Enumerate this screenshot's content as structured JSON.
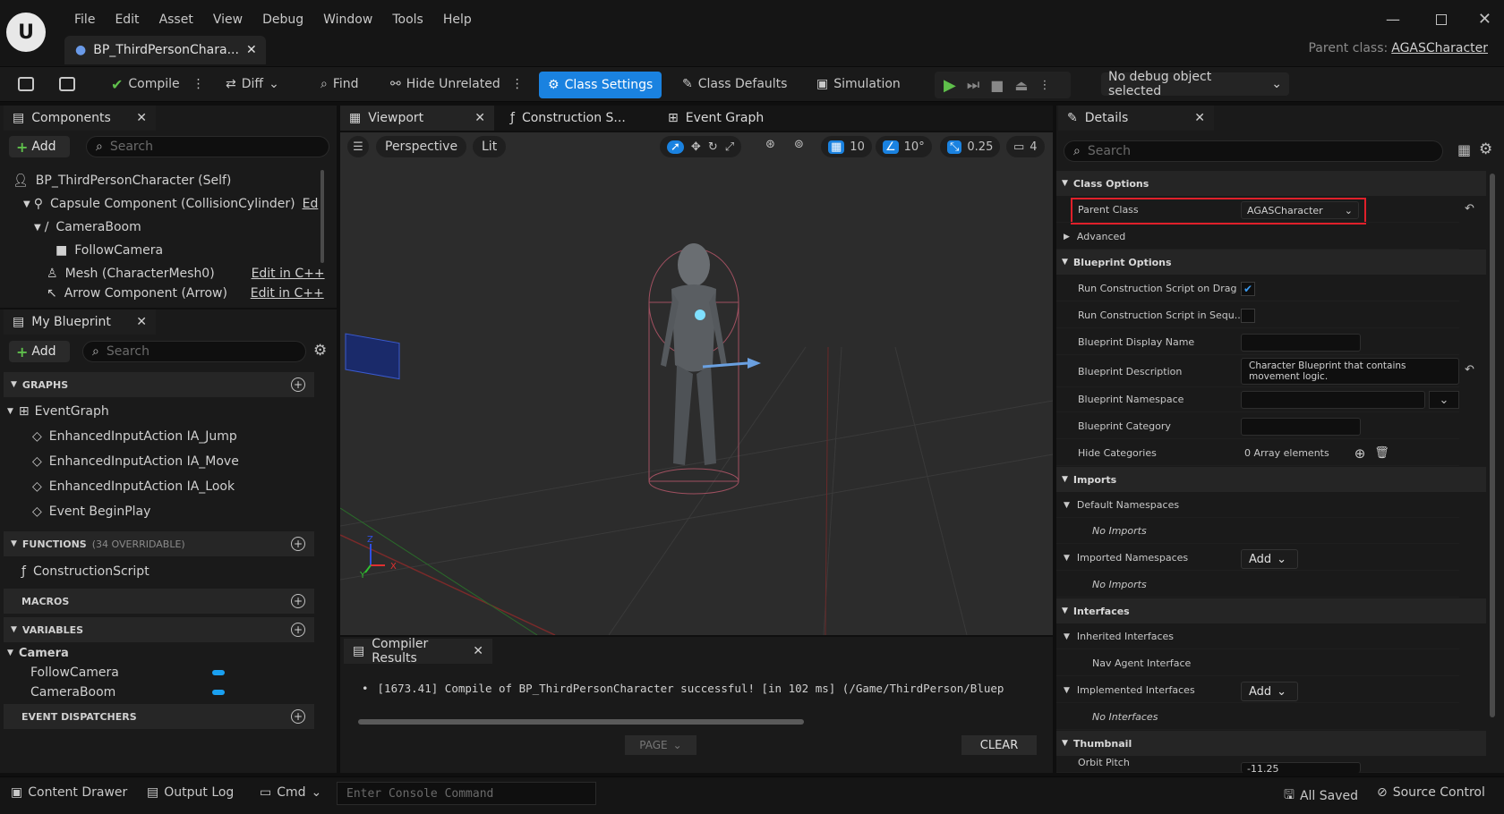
{
  "menu": [
    "File",
    "Edit",
    "Asset",
    "View",
    "Debug",
    "Window",
    "Tools",
    "Help"
  ],
  "doc_tab": "BP_ThirdPersonChara...",
  "parent_class_label": "Parent class:",
  "parent_class_value": "AGASCharacter",
  "toolbar": {
    "compile": "Compile",
    "diff": "Diff",
    "find": "Find",
    "hide_unrelated": "Hide Unrelated",
    "class_settings": "Class Settings",
    "class_defaults": "Class Defaults",
    "simulation": "Simulation",
    "debug_select": "No debug object selected"
  },
  "components": {
    "tab": "Components",
    "add": "Add",
    "search_placeholder": "Search",
    "items": [
      {
        "label": "BP_ThirdPersonCharacter (Self)",
        "extra": ""
      },
      {
        "label": "Capsule Component (CollisionCylinder)",
        "extra": "Ed"
      },
      {
        "label": "CameraBoom",
        "extra": ""
      },
      {
        "label": "FollowCamera",
        "extra": ""
      },
      {
        "label": "Mesh (CharacterMesh0)",
        "extra": "Edit in C++"
      },
      {
        "label": "Arrow Component (Arrow)",
        "extra": "Edit in C++"
      }
    ]
  },
  "myblueprint": {
    "tab": "My Blueprint",
    "add": "Add",
    "search_placeholder": "Search",
    "graphs_label": "GRAPHS",
    "event_graph": "EventGraph",
    "events": [
      "EnhancedInputAction IA_Jump",
      "EnhancedInputAction IA_Move",
      "EnhancedInputAction IA_Look",
      "Event BeginPlay"
    ],
    "functions_label": "FUNCTIONS",
    "functions_count": "(34 OVERRIDABLE)",
    "construction_script": "ConstructionScript",
    "macros_label": "MACROS",
    "variables_label": "VARIABLES",
    "var_category": "Camera",
    "variables": [
      "FollowCamera",
      "CameraBoom"
    ],
    "dispatchers_label": "EVENT DISPATCHERS"
  },
  "viewport": {
    "tabs": [
      "Viewport",
      "Construction S...",
      "Event Graph"
    ],
    "perspective": "Perspective",
    "lit": "Lit",
    "grid_snap": "10",
    "rot_snap": "10°",
    "scale_snap": "0.25",
    "cam_speed": "4"
  },
  "compiler": {
    "tab": "Compiler Results",
    "message": "[1673.41] Compile of BP_ThirdPersonCharacter successful! [in 102 ms] (/Game/ThirdPerson/Bluep",
    "page": "PAGE",
    "clear": "CLEAR"
  },
  "details": {
    "tab": "Details",
    "search_placeholder": "Search",
    "class_options": "Class Options",
    "parent_class": "Parent Class",
    "parent_class_value": "AGASCharacter",
    "advanced": "Advanced",
    "blueprint_options": "Blueprint Options",
    "run_on_drag": "Run Construction Script on Drag",
    "run_in_seq": "Run Construction Script in Sequ...",
    "display_name": "Blueprint Display Name",
    "description": "Blueprint Description",
    "description_value": "Character Blueprint that contains movement logic.",
    "namespace": "Blueprint Namespace",
    "category": "Blueprint Category",
    "hide_categories": "Hide Categories",
    "array_elements": "0 Array elements",
    "imports": "Imports",
    "default_namespaces": "Default Namespaces",
    "no_imports": "No Imports",
    "imported_namespaces": "Imported Namespaces",
    "add": "Add",
    "interfaces": "Interfaces",
    "inherited_interfaces": "Inherited Interfaces",
    "nav_agent": "Nav Agent Interface",
    "implemented_interfaces": "Implemented Interfaces",
    "no_interfaces": "No Interfaces",
    "thumbnail": "Thumbnail",
    "orbit_pitch": "Orbit Pitch",
    "orbit_pitch_value": "-11.25"
  },
  "statusbar": {
    "content_drawer": "Content Drawer",
    "output_log": "Output Log",
    "cmd": "Cmd",
    "console_placeholder": "Enter Console Command",
    "all_saved": "All Saved",
    "source_control": "Source Control"
  },
  "colors": {
    "accent": "#1a82e0",
    "highlight": "#e0202a",
    "play": "#5fbf4b"
  }
}
